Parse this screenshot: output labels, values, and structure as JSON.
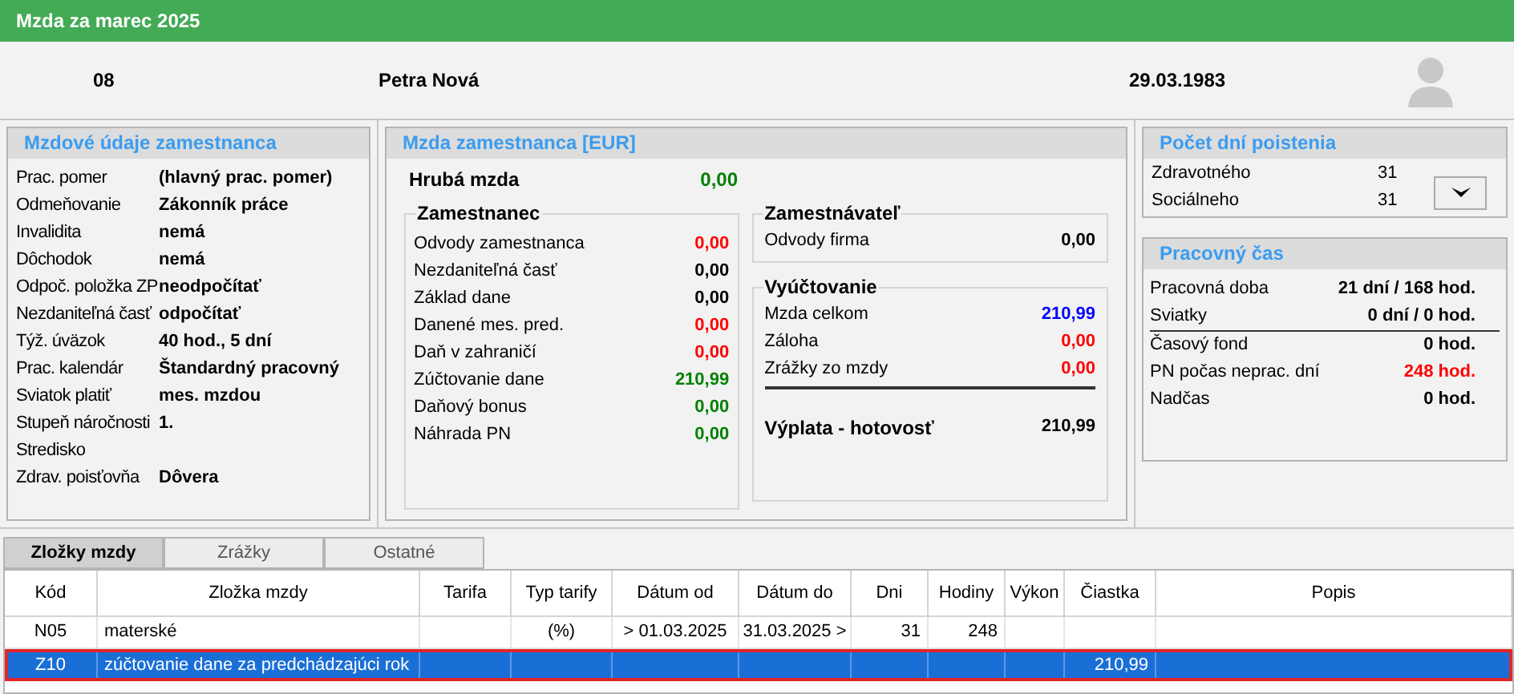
{
  "window": {
    "title": "Mzda za marec 2025"
  },
  "header": {
    "number": "08",
    "name": "Petra Nová",
    "birth_date": "29.03.1983"
  },
  "employee_panel": {
    "title": "Mzdové údaje zamestnanca",
    "rows": [
      {
        "label": "Prac. pomer",
        "value": "(hlavný prac. pomer)"
      },
      {
        "label": "Odmeňovanie",
        "value": "Zákonník práce"
      },
      {
        "label": "Invalidita",
        "value": "nemá"
      },
      {
        "label": "Dôchodok",
        "value": "nemá"
      },
      {
        "label": "Odpoč. položka ZP",
        "value": "neodpočítať"
      },
      {
        "label": "Nezdaniteľná časť",
        "value": "odpočítať"
      },
      {
        "label": "Týž. úväzok",
        "value": "40 hod., 5 dní"
      },
      {
        "label": "Prac. kalendár",
        "value": "Štandardný pracovný"
      },
      {
        "label": "Sviatok platiť",
        "value": "mes. mzdou"
      },
      {
        "label": "Stupeň náročnosti",
        "value": "1."
      },
      {
        "label": "Stredisko"
      },
      {
        "label": "Zdrav. poisťovňa",
        "value": "Dôvera"
      }
    ]
  },
  "wage_panel": {
    "title": "Mzda zamestnanca [EUR]",
    "gross": {
      "label": "Hrubá mzda",
      "value": "0,00",
      "color": "#008000"
    },
    "employee": {
      "title": "Zamestnanec",
      "rows": [
        {
          "label": "Odvody zamestnanca",
          "value": "0,00",
          "color": "#ff0000"
        },
        {
          "label": "Nezdaniteľná časť",
          "value": "0,00",
          "color": "#000000"
        },
        {
          "label": "Základ dane",
          "value": "0,00",
          "color": "#000000"
        },
        {
          "label": "Danené mes. pred.",
          "value": "0,00",
          "color": "#ff0000"
        },
        {
          "label": "Daň v zahraničí",
          "value": "0,00",
          "color": "#ff0000"
        },
        {
          "label": "Zúčtovanie dane",
          "value": "210,99",
          "color": "#008000"
        },
        {
          "label": "Daňový bonus",
          "value": "0,00",
          "color": "#008000"
        },
        {
          "label": "Náhrada PN",
          "value": "0,00",
          "color": "#008000"
        }
      ]
    },
    "employer": {
      "title": "Zamestnávateľ",
      "rows": [
        {
          "label": "Odvody firma",
          "value": "0,00",
          "color": "#000000"
        }
      ]
    },
    "settlement": {
      "title": "Vyúčtovanie",
      "rows": [
        {
          "label": "Mzda celkom",
          "value": "210,99",
          "color": "#0000ff"
        },
        {
          "label": "Záloha",
          "value": "0,00",
          "color": "#ff0000"
        },
        {
          "label": "Zrážky zo mzdy",
          "value": "0,00",
          "color": "#ff0000"
        }
      ],
      "total": {
        "label": "Výplata - hotovosť",
        "value": "210,99"
      }
    }
  },
  "insurance_panel": {
    "title": "Počet dní poistenia",
    "rows": [
      {
        "label": "Zdravotného",
        "value": "31"
      },
      {
        "label": "Sociálneho",
        "value": "31"
      }
    ]
  },
  "work_time_panel": {
    "title": "Pracovný čas",
    "rows": [
      {
        "label": "Pracovná doba",
        "value": "21 dní / 168 hod.",
        "color": "#000000"
      },
      {
        "label": "Sviatky",
        "value": "0 dní / 0 hod.",
        "color": "#000000"
      },
      {
        "label": "Časový fond",
        "value": "0 hod.",
        "color": "#000000"
      },
      {
        "label": "PN počas neprac. dní",
        "value": "248 hod.",
        "color": "#ff0000"
      },
      {
        "label": "Nadčas",
        "value": "0 hod.",
        "color": "#000000"
      }
    ]
  },
  "tabs": [
    {
      "label": "Zložky mzdy",
      "selected": true
    },
    {
      "label": "Zrážky",
      "selected": false
    },
    {
      "label": "Ostatné",
      "selected": false
    }
  ],
  "table": {
    "columns": [
      "Kód",
      "Zložka mzdy",
      "Tarifa",
      "Typ tarify",
      "Dátum od",
      "Dátum do",
      "Dni",
      "Hodiny",
      "Výkon",
      "Čiastka",
      "Popis"
    ],
    "rows": [
      {
        "selected": false,
        "cells": [
          "N05",
          "materské",
          "",
          "(%)",
          "> 01.03.2025",
          "31.03.2025 >",
          "31",
          "248",
          "",
          "",
          ""
        ]
      },
      {
        "selected": true,
        "cells": [
          "Z10",
          "zúčtovanie dane za predchádzajúci rok",
          "",
          "",
          "",
          "",
          "",
          "",
          "",
          "210,99",
          ""
        ]
      }
    ]
  }
}
